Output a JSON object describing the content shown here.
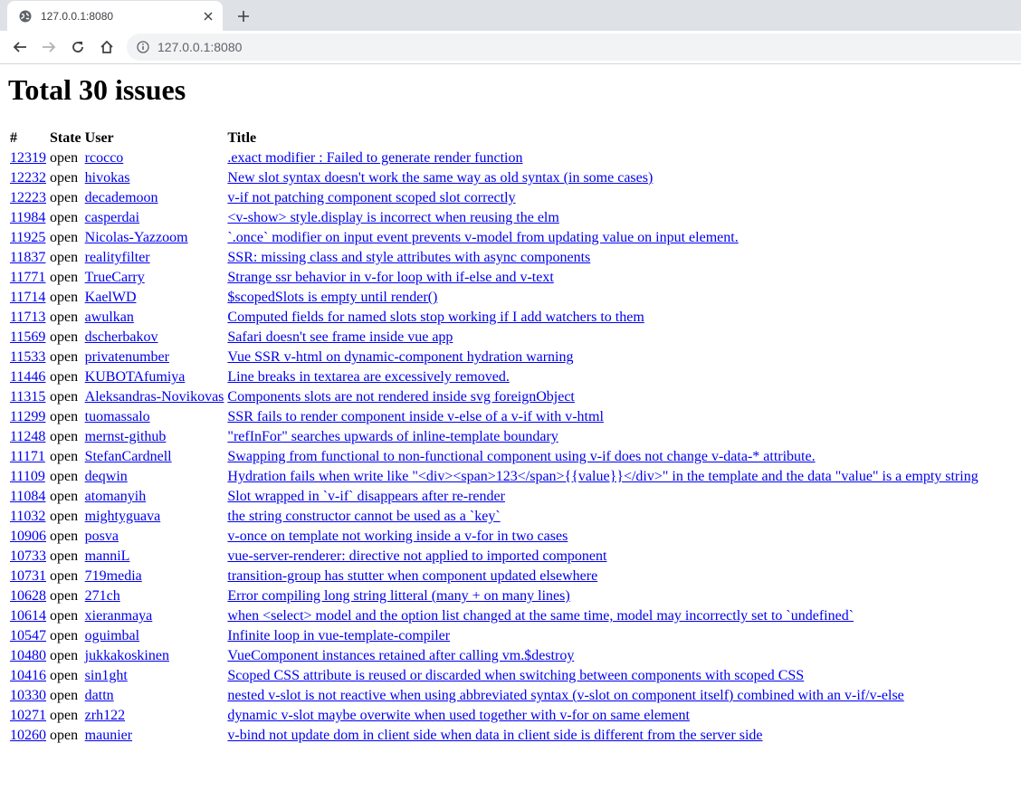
{
  "browser": {
    "tab_title": "127.0.0.1:8080",
    "url": "127.0.0.1:8080"
  },
  "page": {
    "title": "Total 30 issues",
    "columns": {
      "num": "#",
      "state": "State",
      "user": "User",
      "title": "Title"
    },
    "issues": [
      {
        "num": "12319",
        "state": "open",
        "user": "rcocco",
        "title": ".exact modifier : Failed to generate render function"
      },
      {
        "num": "12232",
        "state": "open",
        "user": "hivokas",
        "title": "New slot syntax doesn't work the same way as old syntax (in some cases)"
      },
      {
        "num": "12223",
        "state": "open",
        "user": "decademoon",
        "title": "v-if not patching component scoped slot correctly"
      },
      {
        "num": "11984",
        "state": "open",
        "user": "casperdai",
        "title": "<v-show> style.display is incorrect when reusing the elm"
      },
      {
        "num": "11925",
        "state": "open",
        "user": "Nicolas-Yazzoom",
        "title": "`.once` modifier on input event prevents v-model from updating value on input element."
      },
      {
        "num": "11837",
        "state": "open",
        "user": "realityfilter",
        "title": "SSR: missing class and style attributes with async components"
      },
      {
        "num": "11771",
        "state": "open",
        "user": "TrueCarry",
        "title": "Strange ssr behavior in v-for loop with if-else and v-text"
      },
      {
        "num": "11714",
        "state": "open",
        "user": "KaelWD",
        "title": "$scopedSlots is empty until render()"
      },
      {
        "num": "11713",
        "state": "open",
        "user": "awulkan",
        "title": "Computed fields for named slots stop working if I add watchers to them"
      },
      {
        "num": "11569",
        "state": "open",
        "user": "dscherbakov",
        "title": "Safari doesn't see frame inside vue app"
      },
      {
        "num": "11533",
        "state": "open",
        "user": "privatenumber",
        "title": "Vue SSR v-html on dynamic-component hydration warning"
      },
      {
        "num": "11446",
        "state": "open",
        "user": "KUBOTAfumiya",
        "title": "Line breaks in textarea are excessively removed."
      },
      {
        "num": "11315",
        "state": "open",
        "user": "Aleksandras-Novikovas",
        "title": "Components slots are not rendered inside svg foreignObject"
      },
      {
        "num": "11299",
        "state": "open",
        "user": "tuomassalo",
        "title": "SSR fails to render component inside v-else of a v-if with v-html"
      },
      {
        "num": "11248",
        "state": "open",
        "user": "mernst-github",
        "title": "\"refInFor\" searches upwards of inline-template boundary"
      },
      {
        "num": "11171",
        "state": "open",
        "user": "StefanCardnell",
        "title": "Swapping from functional to non-functional component using v-if does not change v-data-* attribute."
      },
      {
        "num": "11109",
        "state": "open",
        "user": "deqwin",
        "title": "Hydration fails when write like \"<div><span>123</span>{{value}}</div>\" in the template and the data \"value\" is a empty string"
      },
      {
        "num": "11084",
        "state": "open",
        "user": "atomanyih",
        "title": "Slot wrapped in `v-if` disappears after re-render"
      },
      {
        "num": "11032",
        "state": "open",
        "user": "mightyguava",
        "title": "the string constructor cannot be used as a `key`"
      },
      {
        "num": "10906",
        "state": "open",
        "user": "posva",
        "title": "v-once on template not working inside a v-for in two cases"
      },
      {
        "num": "10733",
        "state": "open",
        "user": "manniL",
        "title": "vue-server-renderer: directive not applied to imported component"
      },
      {
        "num": "10731",
        "state": "open",
        "user": "719media",
        "title": "transition-group has stutter when component updated elsewhere"
      },
      {
        "num": "10628",
        "state": "open",
        "user": "271ch",
        "title": "Error compiling long string litteral (many + on many lines)"
      },
      {
        "num": "10614",
        "state": "open",
        "user": "xieranmaya",
        "title": "when <select> model and the option list changed at the same time, model may incorrectly set to `undefined`"
      },
      {
        "num": "10547",
        "state": "open",
        "user": "oguimbal",
        "title": "Infinite loop in vue-template-compiler"
      },
      {
        "num": "10480",
        "state": "open",
        "user": "jukkakoskinen",
        "title": "VueComponent instances retained after calling vm.$destroy"
      },
      {
        "num": "10416",
        "state": "open",
        "user": "sin1ght",
        "title": "Scoped CSS attribute is reused or discarded when switching between components with scoped CSS"
      },
      {
        "num": "10330",
        "state": "open",
        "user": "dattn",
        "title": "nested v-slot is not reactive when using abbreviated syntax (v-slot on component itself) combined with an v-if/v-else"
      },
      {
        "num": "10271",
        "state": "open",
        "user": "zrh122",
        "title": "dynamic v-slot maybe overwite when used together with v-for on same element"
      },
      {
        "num": "10260",
        "state": "open",
        "user": "maunier",
        "title": "v-bind not update dom in client side when data in client side is different from the server side"
      }
    ]
  }
}
